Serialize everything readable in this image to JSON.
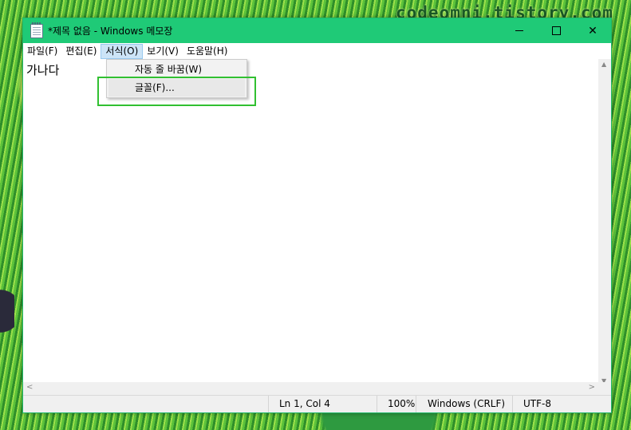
{
  "watermark": "codeomni.tistory.com",
  "window": {
    "title": "*제목 없음 - Windows 메모장",
    "icon": "notepad-icon"
  },
  "controls": {
    "minimize": "minimize-icon",
    "maximize": "maximize-icon",
    "close": "✕"
  },
  "menu": [
    "파일(F)",
    "편집(E)",
    "서식(O)",
    "보기(V)",
    "도움말(H)"
  ],
  "active_menu": "서식(O)",
  "dropdown": {
    "items": [
      "자동 줄 바꿈(W)",
      "글꼴(F)..."
    ]
  },
  "editor": {
    "text": "가나다"
  },
  "scroll": {
    "up": "▲",
    "down": "▼",
    "left": "<",
    "right": ">"
  },
  "status": {
    "position": "Ln 1, Col 4",
    "zoom": "100%",
    "line_ending": "Windows (CRLF)",
    "encoding": "UTF-8"
  },
  "colors": {
    "titlebar": "#1fca77",
    "highlight": "#31c031",
    "active_menu": "#cce4f7"
  }
}
